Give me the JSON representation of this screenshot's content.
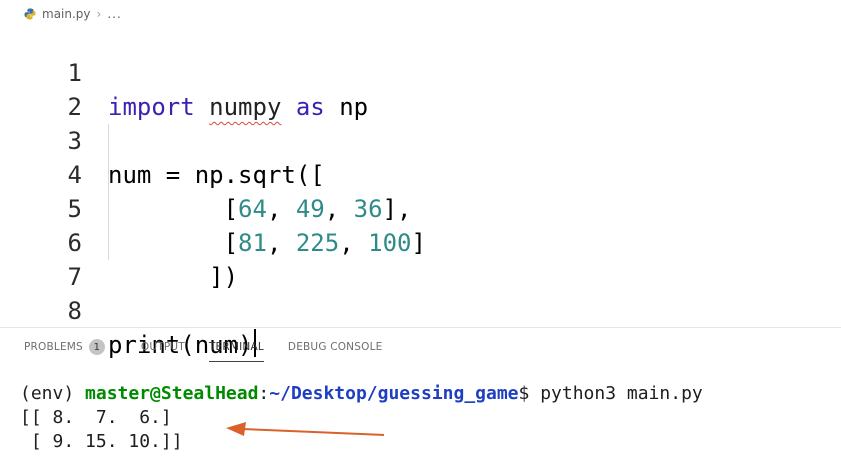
{
  "breadcrumb": {
    "file": "main.py",
    "separator": "›",
    "more": "..."
  },
  "editor": {
    "lines": [
      {
        "n": "1",
        "parts": [
          [
            "kw",
            "import"
          ],
          [
            "",
            "&nbsp;"
          ],
          [
            "sq",
            "numpy"
          ],
          [
            "",
            "&nbsp;"
          ],
          [
            "kw",
            "as"
          ],
          [
            "",
            "&nbsp;np"
          ]
        ]
      },
      {
        "n": "2",
        "parts": []
      },
      {
        "n": "3",
        "parts": [
          [
            "",
            "num = np.sqrt(["
          ]
        ]
      },
      {
        "n": "4",
        "parts": [
          [
            "",
            "        ["
          ],
          [
            "num",
            "64"
          ],
          [
            "",
            ", "
          ],
          [
            "num",
            "49"
          ],
          [
            "",
            ", "
          ],
          [
            "num",
            "36"
          ],
          [
            "",
            "],"
          ]
        ]
      },
      {
        "n": "5",
        "parts": [
          [
            "",
            "        ["
          ],
          [
            "num",
            "81"
          ],
          [
            "",
            ", "
          ],
          [
            "num",
            "225"
          ],
          [
            "",
            ", "
          ],
          [
            "num",
            "100"
          ],
          [
            "",
            "]"
          ]
        ]
      },
      {
        "n": "6",
        "parts": [
          [
            "",
            "       ])"
          ]
        ]
      },
      {
        "n": "7",
        "parts": []
      },
      {
        "n": "8",
        "parts": [
          [
            "",
            "print(num)"
          ]
        ]
      }
    ],
    "line_numbers": [
      "1",
      "2",
      "3",
      "4",
      "5",
      "6",
      "7",
      "8"
    ],
    "text": {
      "l1_import": "import",
      "l1_numpy": "numpy",
      "l1_as": "as",
      "l1_np": "np",
      "l3": "num = np.sqrt([",
      "l4_open": "        [",
      "l4_a": "64",
      "l4_b": "49",
      "l4_c": "36",
      "l4_close": "],",
      "l5_open": "        [",
      "l5_a": "81",
      "l5_b": "225",
      "l5_c": "100",
      "l5_close": "]",
      "l6": "       ])",
      "l8": "print(num)",
      "comma": ", "
    }
  },
  "panel": {
    "tabs": {
      "problems": "PROBLEMS",
      "problems_count": "1",
      "output": "OUTPUT",
      "terminal": "TERMINAL",
      "debug": "DEBUG CONSOLE"
    }
  },
  "terminal": {
    "env": "(env) ",
    "user_host": "master@StealHead",
    "colon": ":",
    "path": "~/Desktop/guessing_game",
    "prompt_cmd": "$ python3 main.py",
    "out1": "[[ 8.  7.  6.]",
    "out2": " [ 9. 15. 10.]]"
  },
  "colors": {
    "keyword": "#3c1fb3",
    "number": "#2f8b87",
    "arrow": "#d9622b",
    "user": "#008a00",
    "path": "#1f3fc2"
  }
}
